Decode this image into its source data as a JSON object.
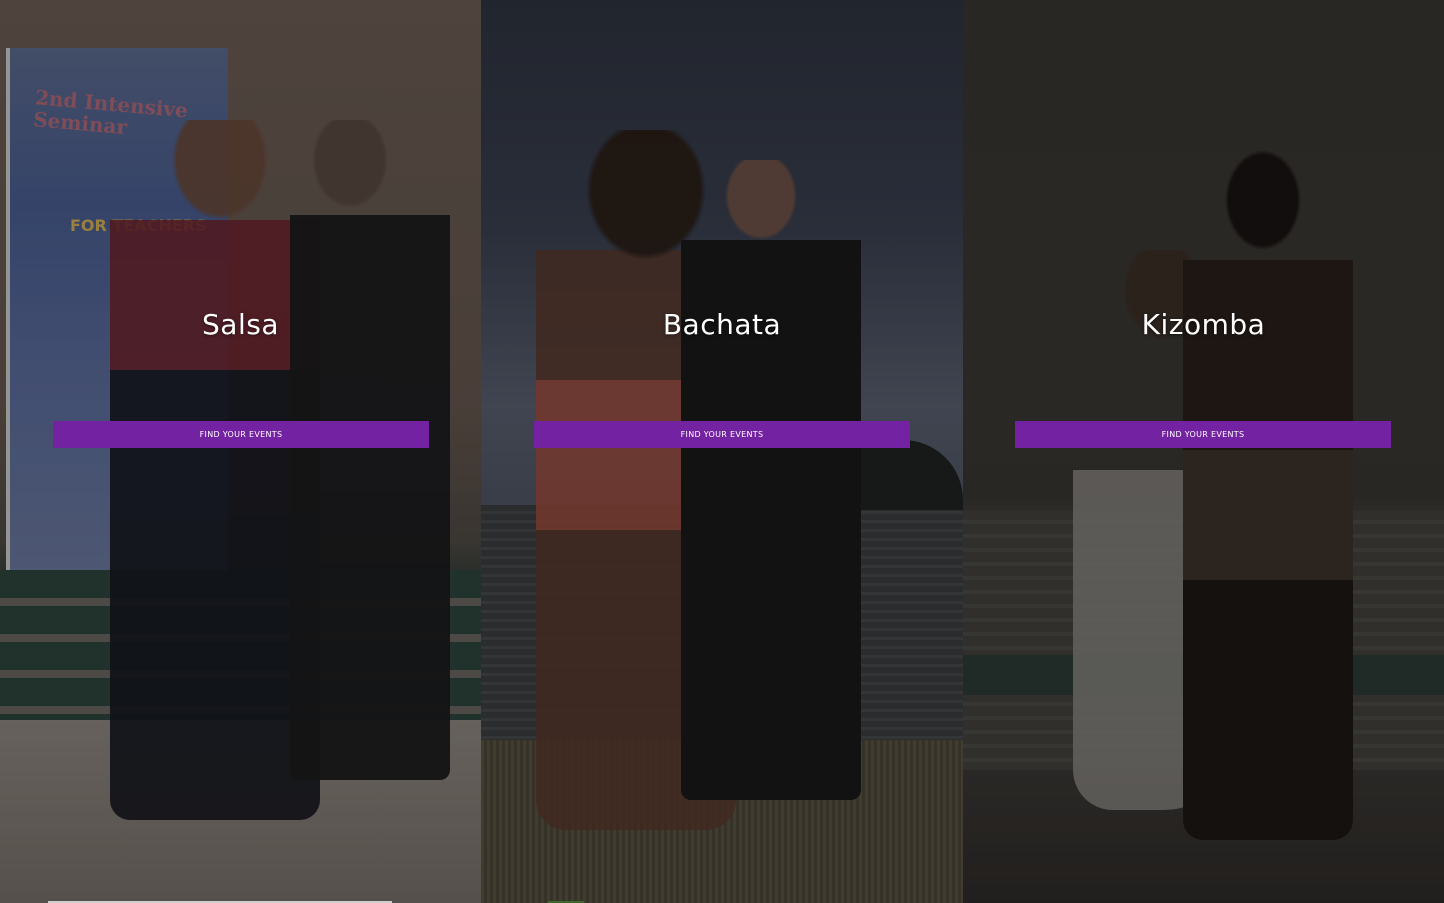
{
  "theme": {
    "button_color": "#7322a2",
    "heading_color": "#ffffff",
    "overlay_color": "rgba(0,0,0,0.28)"
  },
  "panels": [
    {
      "title": "Salsa",
      "button_label": "FIND YOUR EVENTS",
      "banner": {
        "title": "2nd Intensive Seminar",
        "subtitle": "FOR TEACHERS"
      }
    },
    {
      "title": "Bachata",
      "button_label": "FIND YOUR EVENTS"
    },
    {
      "title": "Kizomba",
      "button_label": "FIND YOUR EVENTS"
    }
  ]
}
